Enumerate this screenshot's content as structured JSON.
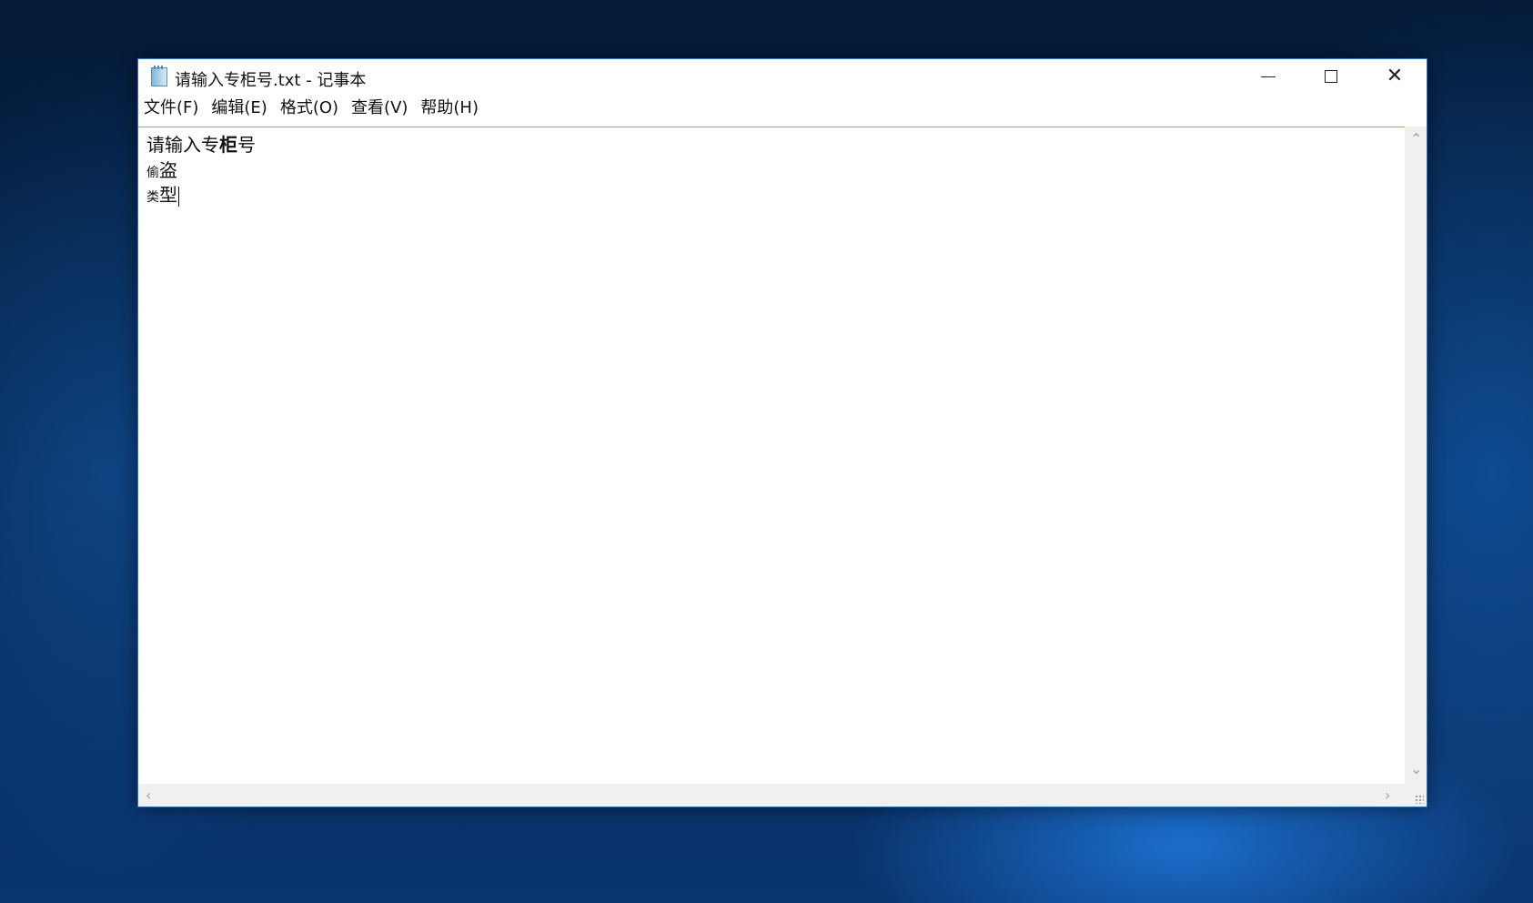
{
  "window": {
    "title": "请输入专柜号.txt - 记事本",
    "controls": {
      "minimize": "—",
      "maximize": "□",
      "close": "✕"
    }
  },
  "menu": {
    "items": [
      {
        "label": "文件(F)"
      },
      {
        "label": "编辑(E)"
      },
      {
        "label": "格式(O)"
      },
      {
        "label": "查看(V)"
      },
      {
        "label": "帮助(H)"
      }
    ]
  },
  "editor": {
    "line1": {
      "part1": "请输入专",
      "part2": "柜",
      "part3": "号"
    },
    "line2": {
      "small": "偷",
      "rest": "盗"
    },
    "line3": {
      "small": "类",
      "rest": "型"
    }
  },
  "scrollbars": {
    "up_icon": "chevron-up",
    "down_icon": "chevron-down",
    "left_icon": "chevron-left",
    "right_icon": "chevron-right"
  },
  "colors": {
    "window_border": "#2b6fc4",
    "desktop": "#06244a"
  }
}
